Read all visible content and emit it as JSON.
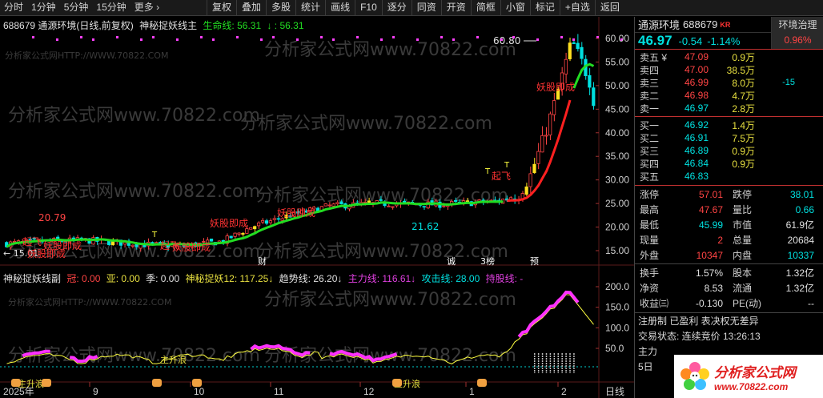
{
  "toolbar": {
    "left": [
      "分时",
      "1分钟",
      "5分钟",
      "15分钟",
      "更多 ›"
    ],
    "right": [
      "复权",
      "叠加",
      "多股",
      "统计",
      "画线",
      "F10",
      "逐分",
      "同资",
      "开资",
      "简框",
      "小窗",
      "标记",
      "+自选",
      "返回"
    ]
  },
  "main_legend": {
    "title": "688679 通源环境(日线,前复权)",
    "indicator": "神秘捉妖线主",
    "life_label": "生命线: 56.31",
    "life_val": "↓ : 56.31",
    "arrow": "↓"
  },
  "sub_legend": {
    "name": "神秘捉妖线副",
    "guan": "冠: 0.00",
    "ya": "亚: 0.00",
    "ji": "季: 0.00",
    "sm12": "神秘捉妖12: 117.25",
    "sm12_arrow": "↓",
    "trend": "趋势线: 26.20",
    "trend_arrow": "↓",
    "main": "主力线: 116.61",
    "main_arrow": "↓",
    "attack": "攻击线: 28.00",
    "hold": "持股线: -"
  },
  "chart_labels": {
    "watermark": "分析家公式网HTTP://WWW.70822.COM",
    "watermark2": "分析家公式网www.70822.com",
    "high_label": "60.80",
    "low_label": "21.62",
    "left_label": "20.79",
    "left_low": "15.01",
    "events": [
      "起飞",
      "妖股即成",
      "起飞",
      "妖股即成",
      "妖股即成",
      "起飞",
      "妖股即成"
    ],
    "sub_events": [
      "主升浪",
      "主升浪",
      "主升浪"
    ],
    "markers": [
      "财",
      "诚",
      "3榜",
      "预"
    ]
  },
  "y_axis_main": [
    "60.00",
    "55.00",
    "50.00",
    "45.00",
    "40.00",
    "35.00",
    "30.00",
    "25.00",
    "20.00",
    "15.00"
  ],
  "y_axis_sub": [
    "200.0",
    "150.0",
    "100.0",
    "50.0"
  ],
  "x_axis": [
    "2025年",
    "9",
    "10",
    "11",
    "12",
    "1",
    "2",
    "日线"
  ],
  "stock": {
    "name": "通源环境",
    "code": "688679",
    "kr": "KR",
    "tag1": "环境治理",
    "tag2": "0.96%",
    "price": "46.97",
    "change": "-0.54",
    "pct": "-1.14%"
  },
  "sell": [
    {
      "lbl": "卖五 ¥",
      "p": "47.09",
      "v": "0.9万",
      "x": ""
    },
    {
      "lbl": "卖四",
      "p": "47.00",
      "v": "38.5万",
      "x": ""
    },
    {
      "lbl": "卖三",
      "p": "46.99",
      "v": "8.0万",
      "x": "-15"
    },
    {
      "lbl": "卖二",
      "p": "46.98",
      "v": "4.7万",
      "x": ""
    },
    {
      "lbl": "卖一",
      "p": "46.97",
      "v": "2.8万",
      "x": ""
    }
  ],
  "buy": [
    {
      "lbl": "买一",
      "p": "46.92",
      "v": "1.4万"
    },
    {
      "lbl": "买二",
      "p": "46.91",
      "v": "7.5万"
    },
    {
      "lbl": "买三",
      "p": "46.89",
      "v": "0.9万"
    },
    {
      "lbl": "买四",
      "p": "46.84",
      "v": "0.9万"
    },
    {
      "lbl": "买五",
      "p": "46.83",
      "v": ""
    }
  ],
  "quote": [
    {
      "k": "涨停",
      "v": "57.01",
      "vc": "red",
      "k2": "跌停",
      "v2": "38.01",
      "v2c": "green"
    },
    {
      "k": "最高",
      "v": "47.67",
      "vc": "red",
      "k2": "量比",
      "v2": "0.66",
      "v2c": "green"
    },
    {
      "k": "最低",
      "v": "45.99",
      "vc": "green",
      "k2": "市值",
      "v2": "61.9亿",
      "v2c": "white"
    },
    {
      "k": "现量",
      "v": "2",
      "vc": "red",
      "k2": "总量",
      "v2": "20684",
      "v2c": "white"
    },
    {
      "k": "外盘",
      "v": "10347",
      "vc": "red",
      "k2": "内盘",
      "v2": "10337",
      "v2c": "green"
    }
  ],
  "quote2": [
    {
      "k": "换手",
      "v": "1.57%",
      "vc": "white",
      "k2": "股本",
      "v2": "1.32亿",
      "v2c": "white"
    },
    {
      "k": "净资",
      "v": "8.53",
      "vc": "white",
      "k2": "流通",
      "v2": "1.32亿",
      "v2c": "white"
    },
    {
      "k": "收益㈢",
      "v": "-0.130",
      "vc": "white",
      "k2": "PE(动)",
      "v2": "--",
      "v2c": "white"
    }
  ],
  "info": {
    "reg": "注册制 已盈利 表决权无差异",
    "status": "交易状态: 连续竞价 13:26:13",
    "main": "主力",
    "day5": "5日"
  },
  "logo": {
    "l1": "分析家公式网",
    "l2": "www.70822.com"
  },
  "colors": {
    "up": "#ff4444",
    "down": "#00e0e0",
    "life_green": "#22dd22",
    "life_red": "#ff2020",
    "magenta": "#ff30ff",
    "yellow": "#ffff40"
  }
}
